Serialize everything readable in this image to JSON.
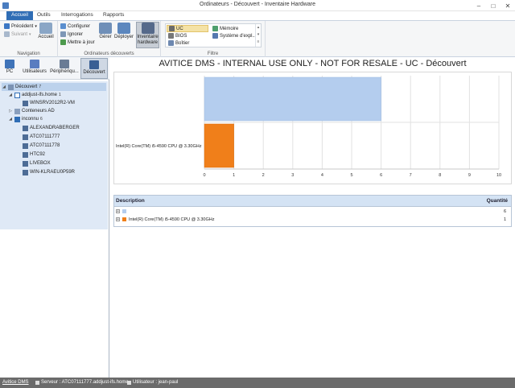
{
  "window": {
    "title": "Ordinateurs - Découvert - Inventaire Hardware"
  },
  "ribbon_tabs": [
    "Accueil",
    "Outils",
    "Interrogations",
    "Rapports"
  ],
  "ribbon": {
    "navigation": {
      "label": "Navigation",
      "precedent": "Précédent",
      "suivant": "Suivant",
      "accueil": "Accueil"
    },
    "discovered": {
      "label": "Ordinateurs découverts",
      "configurer": "Configurer",
      "ignorer": "Ignorer",
      "mettre_a_jour": "Mettre à jour",
      "gerer": "Gérer",
      "deployer": "Déployer",
      "inventaire": "Inventaire",
      "hardware": "hardware"
    },
    "filter": {
      "label": "Filtre",
      "items": [
        "UC",
        "BIOS",
        "Boîtier",
        "Mémoire",
        "Système d'expl..."
      ]
    }
  },
  "sidebar": {
    "tabs": [
      "PC",
      "Utilisateurs",
      "Périphériqu...",
      "Découvert"
    ],
    "tree": {
      "root": {
        "label": "Découvert",
        "count": "7"
      },
      "domain": {
        "label": "addjust-ifs.home",
        "count": "1"
      },
      "domain_child": "WINSRV2012R2-VM",
      "ad": "Conteneurs AD",
      "unknown": {
        "label": "inconnu",
        "count": "6"
      },
      "unknown_children": [
        "ALEXANDRABERGER",
        "ATC07111777",
        "ATC07111778",
        "HTC92",
        "LIVEBOX",
        "WIN-KLRAEU0P59R"
      ]
    }
  },
  "main": {
    "chart_title": "AVITICE DMS - INTERNAL USE ONLY - NOT FOR RESALE - UC - Découvert",
    "table": {
      "col_description": "Description",
      "col_quantite": "Quantité",
      "rows": [
        {
          "label": "",
          "qty": "6"
        },
        {
          "label": "Intel(R) Core(TM) i5-4590 CPU @ 3.30GHz",
          "qty": "1"
        }
      ]
    }
  },
  "chart_data": {
    "type": "bar",
    "orientation": "horizontal",
    "categories": [
      "",
      "Intel(R) Core(TM) i5-4590 CPU @ 3.30GHz"
    ],
    "values": [
      6,
      1
    ],
    "colors": [
      "#b4cdee",
      "#f07f1a"
    ],
    "xlim": [
      0,
      10
    ],
    "xticks": [
      0,
      1,
      2,
      3,
      4,
      5,
      6,
      7,
      8,
      9,
      10
    ],
    "grid": true
  },
  "statusbar": {
    "app": "Avitice DMS",
    "server": "Serveur : ATC07111777.addjust-ifs.home",
    "user": "Utilisateur : jean-paul"
  },
  "colors": {
    "accent": "#2f6db5",
    "status_bg": "#6b6b6b",
    "tree_bg": "#dfe9f6",
    "selection": "#f4e2a6"
  }
}
